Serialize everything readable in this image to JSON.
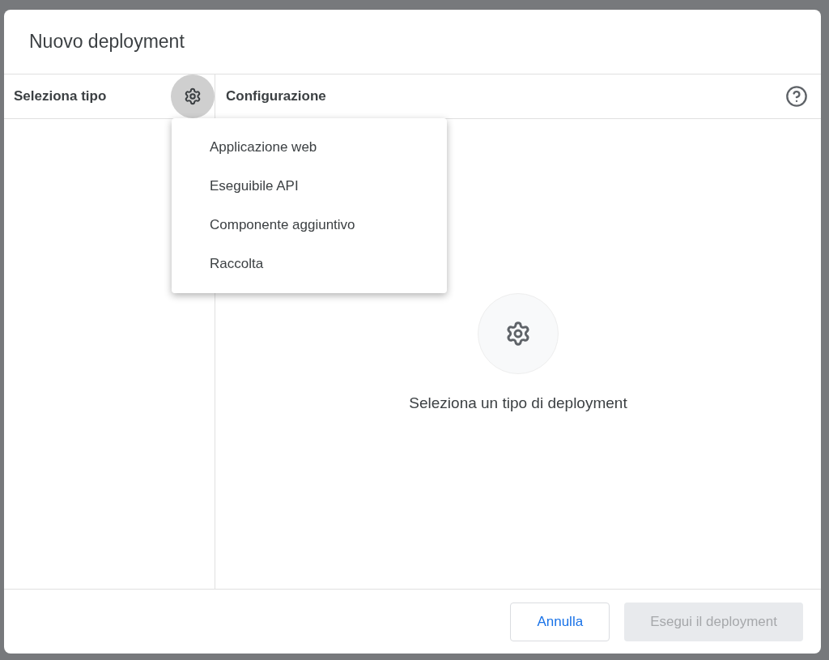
{
  "dialog": {
    "title": "Nuovo deployment"
  },
  "left_panel": {
    "heading": "Seleziona tipo",
    "type_menu_open": true
  },
  "right_panel": {
    "heading": "Configurazione",
    "empty_message": "Seleziona un tipo di deployment"
  },
  "type_menu": {
    "items": [
      {
        "label": "Applicazione web"
      },
      {
        "label": "Eseguibile API"
      },
      {
        "label": "Componente aggiuntivo"
      },
      {
        "label": "Raccolta"
      }
    ]
  },
  "buttons": [
    {
      "label": "Annulla",
      "kind": "secondary",
      "disabled": false
    },
    {
      "label": "Esegui il deployment",
      "kind": "primary",
      "disabled": true
    }
  ]
}
